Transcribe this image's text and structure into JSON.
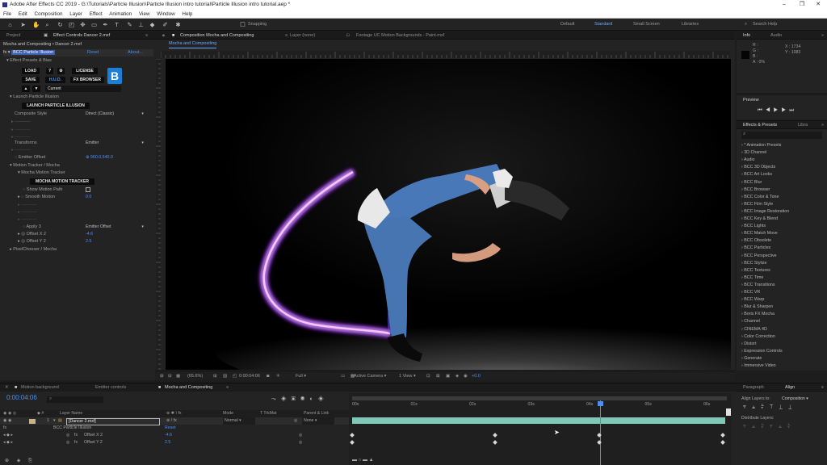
{
  "window": {
    "title": "Adobe After Effects CC 2019 - G:\\Tutorials\\Particle Illusion\\Particle Illusion intro tutorial\\Particle Illusion intro tutorial.aep *",
    "controls": [
      "–",
      "❐",
      "✕"
    ]
  },
  "menu": [
    "File",
    "Edit",
    "Composition",
    "Layer",
    "Effect",
    "Animation",
    "View",
    "Window",
    "Help"
  ],
  "toolbar": {
    "snapping_label": "Snapping",
    "workspaces": [
      "Default",
      "Standard",
      "Small Screen",
      "Libraries"
    ],
    "active_workspace": "Standard",
    "search_placeholder": "Search Help"
  },
  "left_panel": {
    "tab_project": "Project",
    "tab_effect_controls": "Effect Controls Dancer 2.mxf",
    "header": "Mocha and Compositing • Dancer 2.mxf",
    "effect_name": "BCC Particle Illusion",
    "reset": "Reset",
    "about": "About...",
    "presets_label": "Effect Presets & Bias",
    "btn_load": "LOAD",
    "btn_q": "?",
    "btn_gear": "⚙",
    "btn_license": "LICENSE",
    "btn_save": "SAVE",
    "btn_hud": "H.U.D.",
    "btn_fx_browser": "FX BROWSER",
    "btn_current": "Current",
    "launch_group": "Launch Particle Illusion",
    "btn_launch": "LAUNCH PARTICLE ILLUSION",
    "composite_label": "Composite Style",
    "composite_value": "Direct (Classic)",
    "transforms_label": "Transforms",
    "transforms_value": "Emitter",
    "emitter_offset_label": "Emitter Offset",
    "emitter_offset_value": "960.0,540.0",
    "motion_tracker_label": "Motion Tracker / Mocha",
    "mocha_tracker_label": "Mocha Motion Tracker",
    "btn_mocha": "MOCHA MOTION TRACKER",
    "show_motion_path": "Show Motion Path",
    "smooth_motion": "Smooth Motion",
    "smooth_value": "0.0",
    "apply_label": "Apply 3",
    "apply_value": "Emitter Offset",
    "offset_x_label": "Offset X 2",
    "offset_x_value": "-4.6",
    "offset_y_label": "Offset Y 2",
    "offset_y_value": "2.5",
    "pixelchooser": "PixelChooser / Mocha"
  },
  "viewer": {
    "tab_comp": "Composition Mocha and Compositing",
    "tab_layer": "Layer (none)",
    "tab_footage": "Footage UC Motion Backgrounds - Paint.mxf",
    "breadcrumb": "Mocha and Compositing",
    "zoom": "(65.6%)",
    "timecode": "0:00:04:06",
    "resolution": "Full",
    "camera": "Active Camera",
    "views": "1 View",
    "exposure": "+0.0"
  },
  "info_panel": {
    "tab_info": "Info",
    "tab_audio": "Audio",
    "r": "R :",
    "g": "G :",
    "b": "B :",
    "a": "A : 0%",
    "x": "X : 1734",
    "y": "Y : 1083"
  },
  "preview_panel": {
    "title": "Preview"
  },
  "effects_panel": {
    "tab_effects": "Effects & Presets",
    "tab_libs": "Libra",
    "items": [
      "* Animation Presets",
      "3D Channel",
      "Audio",
      "BCC 3D Objects",
      "BCC Art Looks",
      "BCC Blur",
      "BCC Browser",
      "BCC Color & Tone",
      "BCC Film Style",
      "BCC Image Restoration",
      "BCC Key & Blend",
      "BCC Lights",
      "BCC Match Move",
      "BCC Obsolete",
      "BCC Particles",
      "BCC Perspective",
      "BCC Stylize",
      "BCC Textures",
      "BCC Time",
      "BCC Transitions",
      "BCC VR",
      "BCC Warp",
      "Blur & Sharpen",
      "Boris FX Mocha",
      "Channel",
      "CINEMA 4D",
      "Color Correction",
      "Distort",
      "Expression Controls",
      "Generate",
      "Immersive Video"
    ]
  },
  "paragraph_panel": {
    "tab_paragraph": "Paragraph",
    "tab_align": "Align",
    "align_layers_to": "Align Layers to:",
    "align_target": "Composition",
    "distribute": "Distribute Layers:"
  },
  "timeline": {
    "tabs": [
      "Motion background",
      "Emitter controls",
      "Mocha and Compositing"
    ],
    "timecode": "0:00:04:06",
    "columns": {
      "layer_name": "Layer Name",
      "mode": "Mode",
      "trkmat": "T TrkMat",
      "parent": "Parent & Link"
    },
    "layer_num": "1",
    "layer_name": "[Dancer 2.mxf]",
    "layer_mode": "Normal",
    "layer_parent": "None",
    "effect": "BCC Particle Illusion",
    "reset": "Reset",
    "offset_x_label": "Offset X 2",
    "offset_x_value": "-4.6",
    "offset_y_label": "Offset Y 2",
    "offset_y_value": "2.5",
    "ruler": [
      "00s",
      "01s",
      "02s",
      "03s",
      "04s",
      "05s",
      "06s"
    ]
  },
  "colors": {
    "accent": "#4d8ff2",
    "track_bar": "#7ec9b6",
    "particle": "#b23cff"
  }
}
